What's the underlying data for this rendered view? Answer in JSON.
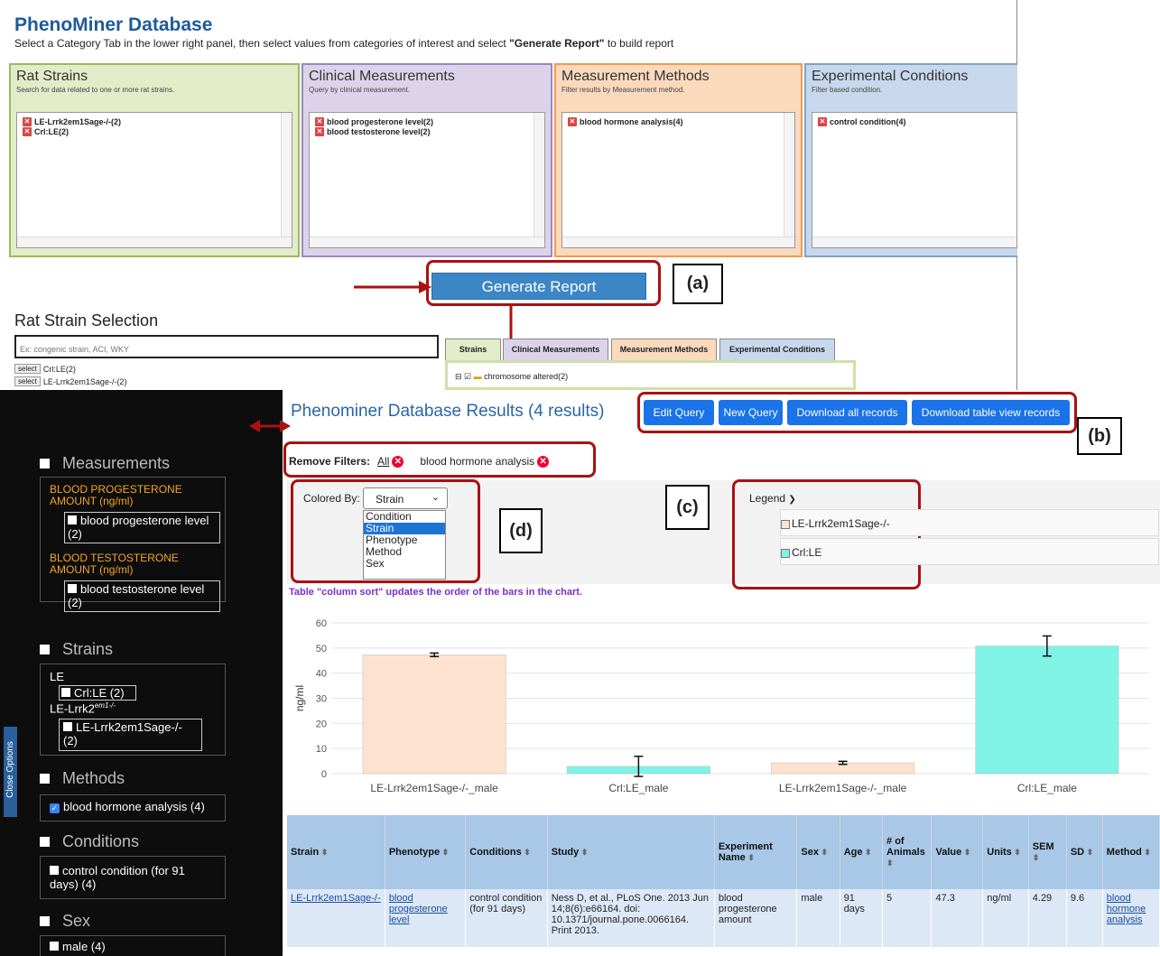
{
  "top": {
    "title": "PhenoMiner Database",
    "subtitle_pre": "Select a Category Tab in the lower right panel, then select values from categories of interest and select ",
    "subtitle_bold": "\"Generate Report\"",
    "subtitle_post": " to build report",
    "panels": [
      {
        "title": "Rat Strains",
        "desc": "Search for data related to one or more rat strains.",
        "items": [
          "LE-Lrrk2em1Sage-/-(2)",
          "Crl:LE(2)"
        ],
        "color": "#e2ecc9",
        "border": "#9bbb59"
      },
      {
        "title": "Clinical Measurements",
        "desc": "Query by clinical measurement.",
        "items": [
          "blood progesterone level(2)",
          "blood testosterone level(2)"
        ],
        "color": "#dcd3ea",
        "border": "#9d86c2"
      },
      {
        "title": "Measurement Methods",
        "desc": "Filter results by Measurement method.",
        "items": [
          "blood hormone analysis(4)"
        ],
        "color": "#fbd9bd",
        "border": "#f29a4e"
      },
      {
        "title": "Experimental Conditions",
        "desc": "Filter based condition.",
        "items": [
          "control condition(4)"
        ],
        "color": "#c8d8ec",
        "border": "#7fa2cc"
      }
    ],
    "generate_label": "Generate Report",
    "label_a": "(a)",
    "strain_selection_title": "Rat Strain Selection",
    "strain_input_placeholder": "Ex: congenic strain, ACI, WKY",
    "select_label": "select",
    "select_rows": [
      "Crl:LE(2)",
      "LE-Lrrk2em1Sage-/-(2)"
    ],
    "tabs": [
      "Strains",
      "Clinical Measurements",
      "Measurement Methods",
      "Experimental Conditions"
    ],
    "tree_item": "chromosome altered(2)"
  },
  "sidebar": {
    "close_tab": "Close Options",
    "measurements_title": "Measurements",
    "prog_heading": "BLOOD PROGESTERONE AMOUNT (ng/ml)",
    "prog_item": "blood progesterone level (2)",
    "test_heading": "BLOOD TESTOSTERONE AMOUNT (ng/ml)",
    "test_item": "blood testosterone level (2)",
    "strains_title": "Strains",
    "strain_group1": "LE",
    "strain_item1": "Crl:LE (2)",
    "strain_group2": "LE-Lrrk2",
    "strain_group2_sup": "em1-/-",
    "strain_item2": "LE-Lrrk2em1Sage-/- (2)",
    "methods_title": "Methods",
    "method_item": "blood hormone analysis (4)",
    "conditions_title": "Conditions",
    "condition_item": "control condition (for 91 days)  (4)",
    "sex_title": "Sex",
    "sex_item": "male (4)"
  },
  "results": {
    "title": "Phenominer Database Results (4 results)",
    "buttons": [
      "Edit Query",
      "New Query",
      "Download all records",
      "Download table view records"
    ],
    "label_b": "(b)",
    "remove_filters": "Remove Filters:",
    "filter_all": "All",
    "filter_method": "blood hormone analysis",
    "colored_by": "Colored By:",
    "colored_value": "Strain",
    "dropdown_options": [
      "Condition",
      "Strain",
      "Phenotype",
      "Method",
      "Sex"
    ],
    "label_d": "(d)",
    "label_c": "(c)",
    "legend_label": "Legend",
    "legend_items": [
      {
        "name": "LE-Lrrk2em1Sage-/-",
        "color": "#fde3cf"
      },
      {
        "name": "Crl:LE",
        "color": "#7ff3e6"
      }
    ],
    "sort_note": "Table \"column sort\" updates the order of the bars in the chart."
  },
  "chart_data": {
    "type": "bar",
    "categories": [
      "LE-Lrrk2em1Sage-/-_male",
      "Crl:LE_male",
      "LE-Lrrk2em1Sage-/-_male",
      "Crl:LE_male"
    ],
    "values": [
      47.3,
      2.9,
      4.3,
      50.8
    ],
    "errors": [
      0.7,
      4.0,
      0.6,
      4.0
    ],
    "colors": [
      "#fde3cf",
      "#7ff3e6",
      "#fde3cf",
      "#7ff3e6"
    ],
    "ylabel": "ng/ml",
    "yticks": [
      0,
      10,
      20,
      30,
      40,
      50,
      60
    ],
    "ylim": [
      0,
      60
    ]
  },
  "table": {
    "headers": [
      "Strain",
      "Phenotype",
      "Conditions",
      "Study",
      "Experiment Name",
      "Sex",
      "Age",
      "# of Animals",
      "Value",
      "Units",
      "SEM",
      "SD",
      "Method"
    ],
    "row1": [
      "LE-Lrrk2em1Sage-/-",
      "blood progesterone level",
      "control condition (for 91 days)",
      "Ness D, et al., PLoS One. 2013 Jun 14;8(6):e66164. doi: 10.1371/journal.pone.0066164. Print 2013.",
      "blood progesterone amount",
      "male",
      "91 days",
      "5",
      "47.3",
      "ng/ml",
      "4.29",
      "9.6",
      "blood hormone analysis"
    ]
  }
}
